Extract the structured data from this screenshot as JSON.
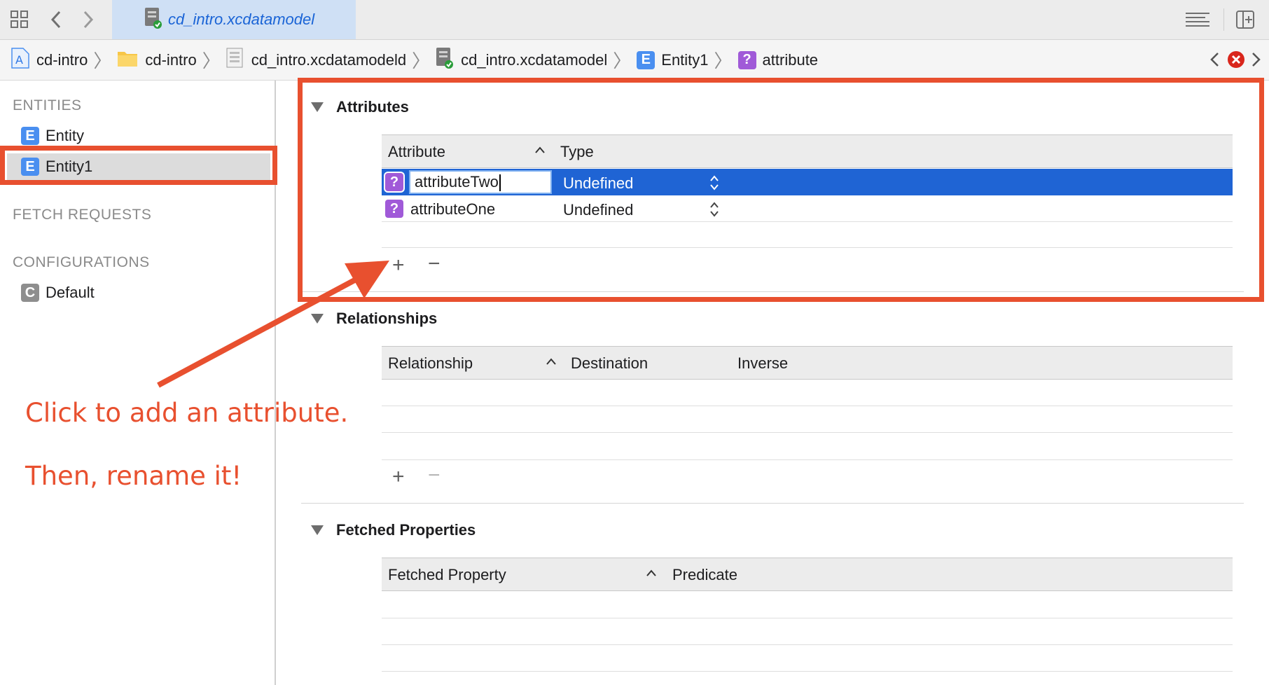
{
  "tabbar": {
    "active_tab_title": "cd_intro.xcdatamodel",
    "icons": [
      "grid-icon",
      "back-chevron-icon",
      "forward-chevron-icon",
      "file-icon",
      "editor-options-icon",
      "add-editor-icon"
    ]
  },
  "breadcrumb": {
    "items": [
      {
        "label": "cd-intro",
        "icon": "app-project-icon"
      },
      {
        "label": "cd-intro",
        "icon": "folder-icon"
      },
      {
        "label": "cd_intro.xcdatamodeld",
        "icon": "datamodel-bundle-icon"
      },
      {
        "label": "cd_intro.xcdatamodel",
        "icon": "datamodel-file-icon"
      },
      {
        "label": "Entity1",
        "icon": "entity-icon"
      },
      {
        "label": "attribute",
        "icon": "attribute-icon"
      }
    ]
  },
  "sidebar": {
    "entities_header": "ENTITIES",
    "entities": [
      {
        "label": "Entity",
        "icon_letter": "E"
      },
      {
        "label": "Entity1",
        "icon_letter": "E",
        "selected": true
      }
    ],
    "fetch_requests_header": "FETCH REQUESTS",
    "configurations_header": "CONFIGURATIONS",
    "configurations": [
      {
        "label": "Default",
        "icon_letter": "C"
      }
    ]
  },
  "attributes": {
    "title": "Attributes",
    "col_attribute": "Attribute",
    "col_type": "Type",
    "rows": [
      {
        "name": "attributeTwo",
        "type": "Undefined",
        "selected": true,
        "editing": true,
        "icon_letter": "?"
      },
      {
        "name": "attributeOne",
        "type": "Undefined",
        "selected": false,
        "icon_letter": "?"
      }
    ],
    "add_button": "+",
    "remove_button": "−"
  },
  "relationships": {
    "title": "Relationships",
    "col_relationship": "Relationship",
    "col_destination": "Destination",
    "col_inverse": "Inverse",
    "add_button": "+",
    "remove_button": "−"
  },
  "fetched_properties": {
    "title": "Fetched Properties",
    "col_property": "Fetched Property",
    "col_predicate": "Predicate"
  },
  "annotation": {
    "line1": "Click to add an attribute.",
    "line2": "Then, rename it!",
    "color": "#e8502f"
  },
  "colors": {
    "selection": "#1f64d4",
    "entity_icon": "#4a8ff0",
    "attribute_icon": "#a05ad8",
    "tab_active": "#cfe0f5"
  }
}
